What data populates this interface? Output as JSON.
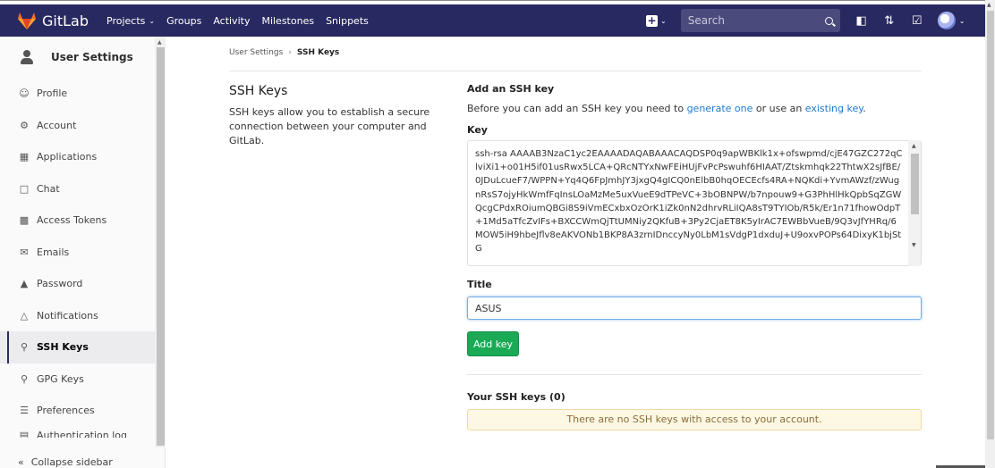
{
  "navbar": {
    "brand": "GitLab",
    "links": [
      {
        "label": "Projects",
        "dropdown": true
      },
      {
        "label": "Groups",
        "dropdown": false
      },
      {
        "label": "Activity",
        "dropdown": false
      },
      {
        "label": "Milestones",
        "dropdown": false
      },
      {
        "label": "Snippets",
        "dropdown": false
      }
    ],
    "search_placeholder": "Search",
    "accent_color": "#292961"
  },
  "sidebar": {
    "header": "User Settings",
    "items": [
      {
        "label": "Profile",
        "icon": "profile-icon",
        "active": false
      },
      {
        "label": "Account",
        "icon": "account-icon",
        "active": false
      },
      {
        "label": "Applications",
        "icon": "applications-icon",
        "active": false
      },
      {
        "label": "Chat",
        "icon": "chat-icon",
        "active": false
      },
      {
        "label": "Access Tokens",
        "icon": "access-tokens-icon",
        "active": false
      },
      {
        "label": "Emails",
        "icon": "emails-icon",
        "active": false
      },
      {
        "label": "Password",
        "icon": "lock-icon",
        "active": false
      },
      {
        "label": "Notifications",
        "icon": "bell-icon",
        "active": false
      },
      {
        "label": "SSH Keys",
        "icon": "key-icon",
        "active": true
      },
      {
        "label": "GPG Keys",
        "icon": "key-icon",
        "active": false
      },
      {
        "label": "Preferences",
        "icon": "sliders-icon",
        "active": false
      },
      {
        "label": "Authentication log",
        "icon": "log-icon",
        "active": false
      }
    ],
    "collapse_label": "Collapse sidebar"
  },
  "breadcrumb": {
    "parent": "User Settings",
    "current": "SSH Keys"
  },
  "intro": {
    "title": "SSH Keys",
    "description": "SSH keys allow you to establish a secure connection between your computer and GitLab."
  },
  "form": {
    "heading": "Add an SSH key",
    "desc_before": "Before you can add an SSH key you need to ",
    "link1": "generate one",
    "desc_middle": " or use an ",
    "link2": "existing key",
    "desc_after": ".",
    "key_label": "Key",
    "key_value": "ssh-rsa AAAAB3NzaC1yc2EAAAADAQABAAACAQDSP0q9apWBKlk1x+ofswpmd/cjE47GZC272qClviXi1+o01H5if01usRwx5LCA+QRcNTYxNwFEiHUjFvPcPswuhf6HIAAT/Ztskmhqk22ThtwX2sJfBE/0JDuLcueF7/WPPN+Yq4Q6FpJmhJY3jxgQ4gICQ0nElbB0hqOECEcfs4RA+NQKdi+YvmAWzf/zWugnRsS7ojyHkWmfFqInsLOaMzMe5uxVueE9dTPeVC+3bOBNPW/b7npouw9+G3PhHlHkQpbSqZGWQcgCPdxROiumQBGi8S9iVmECxbxOzOrK1iZk0nN2dhrvRLiIQA8sT9TYIOb/R5k/Er1n71fhowOdpT+1Md5aTfcZvIFs+BXCCWmQjTtUMNiy2QKfuB+3Py2CjaET8K5yIrAC7EWBbVueB/9Q3vJfYHRq/6MOW5iH9hbeJflv8eAKVONb1BKP8A3zrnIDnccyNy0LbM1sVdgP1dxduJ+U9oxvPOPs64DixyK1bjStG",
    "title_label": "Title",
    "title_value": "ASUS",
    "submit_label": "Add key",
    "submit_color": "#1aaa55"
  },
  "your_keys": {
    "heading": "Your SSH keys (0)",
    "empty_message": "There are no SSH keys with access to your account."
  }
}
